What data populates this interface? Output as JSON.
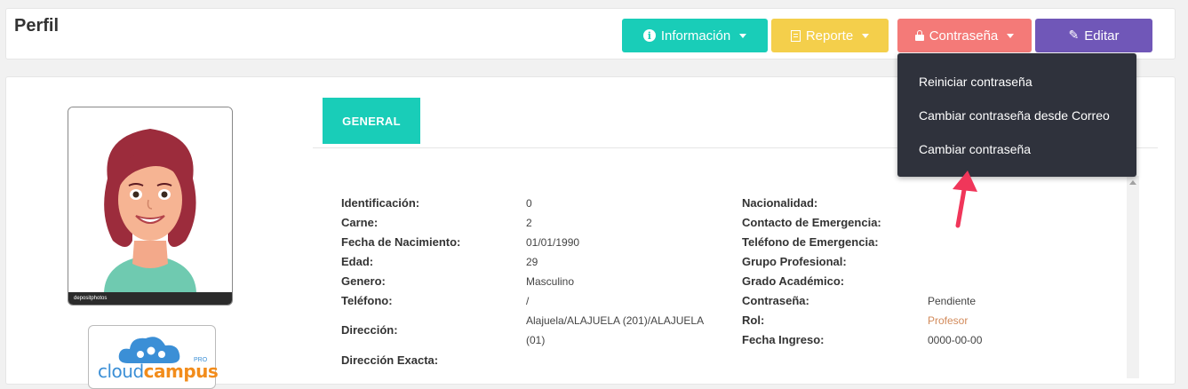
{
  "header": {
    "title": "Perfil",
    "buttons": {
      "info": "Información",
      "report": "Reporte",
      "password": "Contraseña",
      "edit": "Editar"
    }
  },
  "password_menu": {
    "items": [
      "Reiniciar contraseña",
      "Cambiar contraseña desde Correo",
      "Cambiar contraseña"
    ]
  },
  "tabs": {
    "general": "GENERAL"
  },
  "avatar": {
    "watermark": "depositphotos"
  },
  "logo": {
    "text_left": "cloud",
    "text_accent": "campus",
    "badge": "PRO"
  },
  "profile_left": [
    {
      "label": "Identificación:",
      "value": "0"
    },
    {
      "label": "Carne:",
      "value": "2"
    },
    {
      "label": "Fecha de Nacimiento:",
      "value": "01/01/1990"
    },
    {
      "label": "Edad:",
      "value": "29"
    },
    {
      "label": "Genero:",
      "value": "Masculino"
    },
    {
      "label": "Teléfono:",
      "value": "/"
    },
    {
      "label": "Dirección:",
      "value_line1": "Alajuela/ALAJUELA (201)/ALAJUELA",
      "value_line2": "(01)"
    },
    {
      "label": "Dirección Exacta:",
      "value": ""
    }
  ],
  "profile_right": [
    {
      "label": "Nacionalidad:",
      "value": ""
    },
    {
      "label": "Contacto de Emergencia:",
      "value": ""
    },
    {
      "label": "Teléfono de Emergencia:",
      "value": ""
    },
    {
      "label": "Grupo Profesional:",
      "value": ""
    },
    {
      "label": "Grado Académico:",
      "value": ""
    },
    {
      "label": "Contraseña:",
      "value": "Pendiente"
    },
    {
      "label": "Rol:",
      "value": "Profesor"
    },
    {
      "label": "Fecha Ingreso:",
      "value": "0000-00-00"
    }
  ],
  "colors": {
    "info": "#19cdb8",
    "report": "#f4cf4b",
    "password": "#f47a78",
    "edit": "#7057b8",
    "dropdown": "#2f323c",
    "annotation_arrow": "#f0365a"
  }
}
